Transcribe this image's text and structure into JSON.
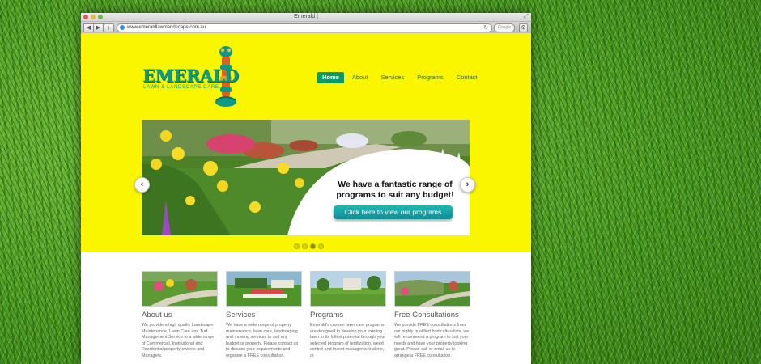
{
  "browser": {
    "window_title": "Emerald |",
    "url": "www.emeraldlawnlandscape.com.au",
    "search_placeholder": "Google"
  },
  "logo": {
    "name": "EMERALD",
    "tagline": "LAWN & LANDSCAPE CARE"
  },
  "nav": {
    "items": [
      {
        "label": "Home",
        "active": true
      },
      {
        "label": "About",
        "active": false
      },
      {
        "label": "Services",
        "active": false
      },
      {
        "label": "Programs",
        "active": false
      },
      {
        "label": "Contact",
        "active": false
      }
    ]
  },
  "slider": {
    "headline_line1": "We have a fantastic range of",
    "headline_line2": "programs to suit any budget!",
    "cta_label": "Click here to view our programs",
    "slide_count": 4,
    "active_slide": 3
  },
  "features": [
    {
      "title": "About us",
      "text": "We provide a high quality Landscape Maintenance, Lawn Care and Turf Management Service to a wide range of Commercial, Institutional and Residential property owners and Managers."
    },
    {
      "title": "Services",
      "text": "We have a wide range of property maintenance, lawn care, landscaping and mowing services to suit any budget or property. Please contact us to discuss your requirements and organise a FREE consultation."
    },
    {
      "title": "Programs",
      "text": "Emerald's custom lawn care programs are designed to develop your existing lawn to its fullest potential through your selected program of fertilization, weed control and insect management alone, or"
    },
    {
      "title": "Free Consultations",
      "text": "We provide FREE consultations from our highly qualified horticulturalists, we will recommend a program to suit your needs and have your property looking great. Please call or email us to arrange a FREE consultation"
    }
  ],
  "colors": {
    "hero_yellow": "#f9f600",
    "brand_green": "#0b9a83",
    "nav_active": "#0a9a62",
    "cta_teal": "#0b8f94"
  }
}
